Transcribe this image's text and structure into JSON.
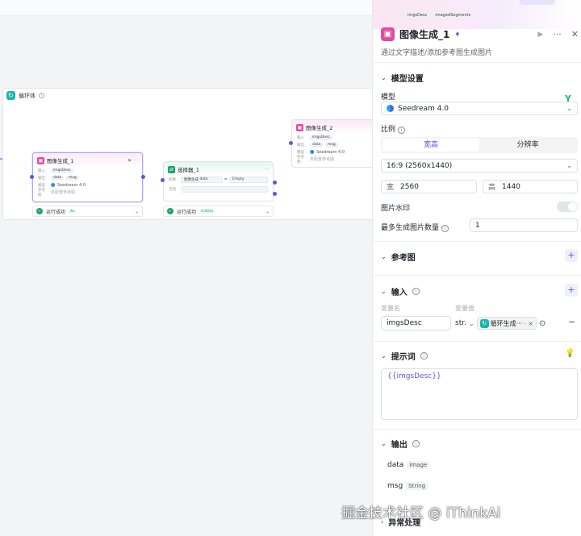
{
  "canvas": {
    "loop_title": "循环体",
    "node1": {
      "title": "图像生成_1",
      "input_label": "输入",
      "input_chip": "imgsDesc",
      "output_label": "输出",
      "output_chips": [
        "data",
        "msg"
      ],
      "model_label": "模型",
      "model": "Seedream 4.0",
      "ref_label": "参考图",
      "ref_value": "未配置参考图",
      "status": "运行成功",
      "time": "4s"
    },
    "node2": {
      "title": "选择器_1",
      "cond_label": "如果",
      "cond_left": "图像生成",
      "cond_var": "data",
      "cond_op": "=",
      "cond_right": "Empty",
      "else_label": "否则",
      "status": "运行成功",
      "time": "0.001s"
    },
    "node3": {
      "title": "图像生成_2",
      "input_label": "输入",
      "input_chip": "imgsDesc",
      "output_label": "输出",
      "output_chips": [
        "data",
        "msg"
      ],
      "model_label": "模型",
      "model": "Seedream 4.0",
      "ref_label": "参考图",
      "ref_value": "未配置参考图"
    },
    "top_chips": [
      "imgsDesc",
      "imagedSegments"
    ]
  },
  "panel": {
    "title": "图像生成_1",
    "description": "通过文字描述/添加参考图生成图片",
    "model_section": "模型设置",
    "model_label": "模型",
    "model_value": "Seedream 4.0",
    "ratio_label": "比例",
    "ratio_tabs": [
      "宽高",
      "分辨率"
    ],
    "ratio_value": "16:9 (2560x1440)",
    "width_prefix": "宽",
    "width_value": "2560",
    "height_prefix": "高",
    "height_value": "1440",
    "watermark_label": "图片水印",
    "max_count_label": "最多生成图片数量",
    "max_count_value": "1",
    "ref_section": "参考图",
    "input_section": "输入",
    "var_name_header": "变量名",
    "var_value_header": "变量值",
    "var_name": "imgsDesc",
    "var_type": "str.",
    "var_ref": "循环生成···",
    "var_ref_suffix": "-",
    "prompt_section": "提示词",
    "prompt_value": "{{imgsDesc}}",
    "output_section": "输出",
    "outputs": [
      {
        "name": "data",
        "type": "Image"
      },
      {
        "name": "msg",
        "type": "String"
      }
    ],
    "error_section": "异常处理"
  },
  "watermark": "掘金技术社区 @ iThinkAi",
  "colors": {
    "accent": "#5b55e8",
    "image_node": "#e34ba0",
    "success": "#22a36b"
  }
}
